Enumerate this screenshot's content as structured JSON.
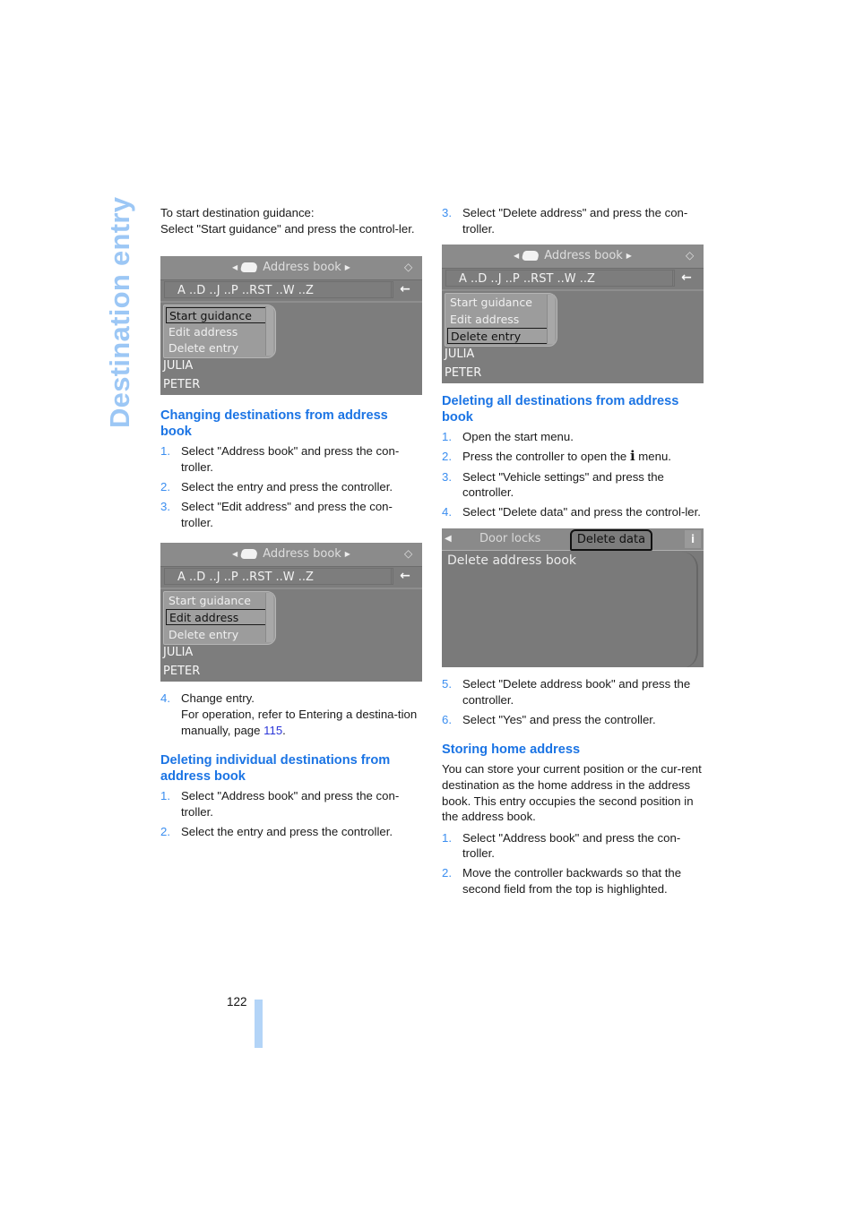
{
  "side_title": "Destination entry",
  "left": {
    "intro": {
      "line1": "To start destination guidance:",
      "line2": "Select \"Start guidance\" and press the control-ler."
    },
    "screen1": {
      "title": "Address book",
      "alphabet": "A ..D ..J ..P ..RST ..W ..Z",
      "back_icon": "back-arrow-icon",
      "menu": [
        "Start guidance",
        "Edit address",
        "Delete entry"
      ],
      "selected_index": 0,
      "entries": [
        "JULIA",
        "PETER"
      ]
    },
    "section_changing": {
      "heading": "Changing destinations from address book",
      "steps": [
        {
          "num": "1.",
          "text": "Select \"Address book\" and press the con-troller."
        },
        {
          "num": "2.",
          "text": "Select the entry and press the controller."
        },
        {
          "num": "3.",
          "text": "Select \"Edit address\" and press the con-troller."
        }
      ]
    },
    "screen2": {
      "title": "Address book",
      "alphabet": "A ..D ..J ..P ..RST ..W ..Z",
      "menu": [
        "Start guidance",
        "Edit address",
        "Delete entry"
      ],
      "selected_index": 1,
      "entries": [
        "JULIA",
        "PETER"
      ]
    },
    "step4": {
      "num": "4.",
      "line1": "Change entry.",
      "line2_prefix": "For operation, refer to Entering a destina-tion manually, page ",
      "page_link": "115",
      "line2_suffix": "."
    },
    "section_individual": {
      "heading": "Deleting individual destinations from address book",
      "steps": [
        {
          "num": "1.",
          "text": "Select \"Address book\" and press the con-troller."
        },
        {
          "num": "2.",
          "text": "Select the entry and press the controller."
        }
      ]
    }
  },
  "right": {
    "step3": {
      "num": "3.",
      "text": "Select \"Delete address\" and press the con-troller."
    },
    "screen3": {
      "title": "Address book",
      "alphabet": "A ..D ..J ..P ..RST ..W ..Z",
      "menu": [
        "Start guidance",
        "Edit address",
        "Delete entry"
      ],
      "selected_index": 2,
      "entries": [
        "JULIA",
        "PETER"
      ]
    },
    "section_all": {
      "heading": "Deleting all destinations from address book",
      "steps": [
        {
          "num": "1.",
          "text": "Open the start menu."
        },
        {
          "num": "2.",
          "text_before": "Press the controller to open the ",
          "icon": "i",
          "text_after": " menu."
        },
        {
          "num": "3.",
          "text": "Select \"Vehicle settings\" and press the controller."
        },
        {
          "num": "4.",
          "text": "Select \"Delete data\" and press the control-ler."
        }
      ]
    },
    "screen4": {
      "tab_left": "Door locks",
      "tab_active": "Delete data",
      "item": "Delete address book",
      "info_icon": "i"
    },
    "steps_after": [
      {
        "num": "5.",
        "text": "Select \"Delete address book\" and press the controller."
      },
      {
        "num": "6.",
        "text": "Select \"Yes\" and press the controller."
      }
    ],
    "section_home": {
      "heading": "Storing home address",
      "body": "You can store your current position or the cur-rent destination as the home address in the address book. This entry occupies the second position in the address book.",
      "steps": [
        {
          "num": "1.",
          "text": "Select \"Address book\" and press the con-troller."
        },
        {
          "num": "2.",
          "text": "Move the controller backwards so that the second field from the top is highlighted."
        }
      ]
    }
  },
  "footer": {
    "page_number": "122"
  },
  "colors": {
    "heading": "#1b74e4",
    "side_title": "#9cc7f5",
    "page_bar": "#b3d4f7"
  }
}
